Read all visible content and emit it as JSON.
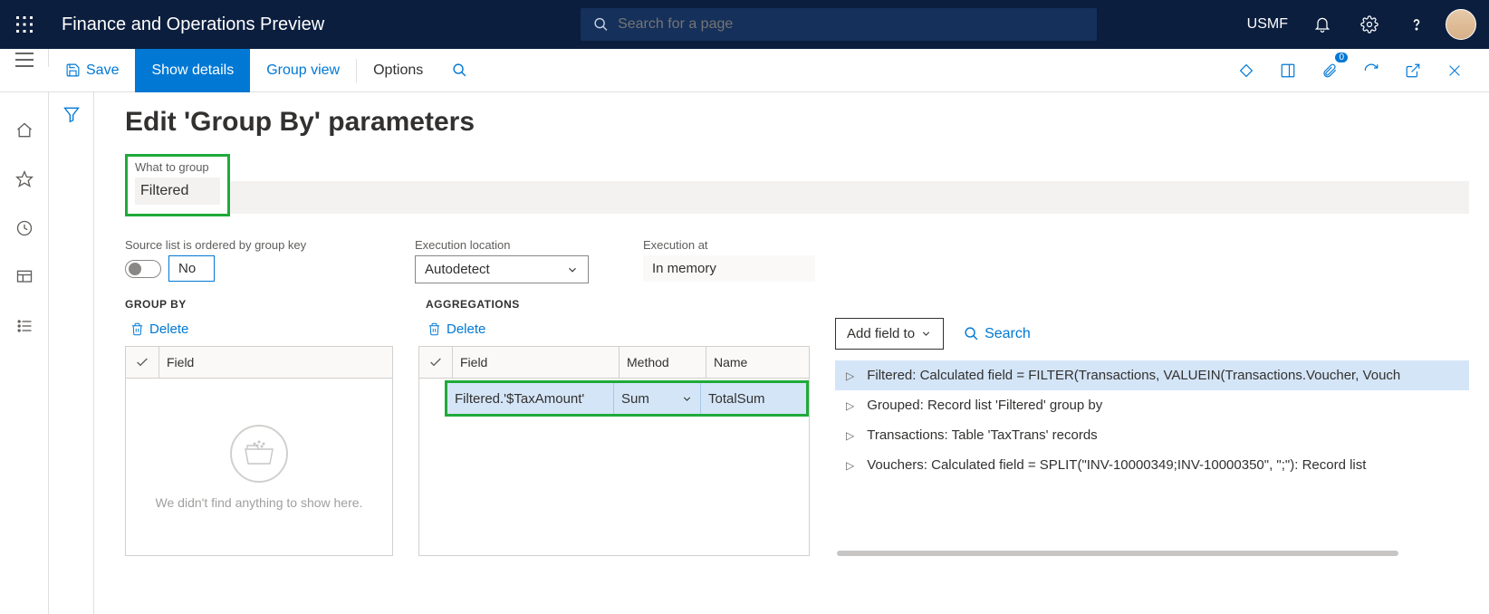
{
  "navbar": {
    "app_title": "Finance and Operations Preview",
    "search_placeholder": "Search for a page",
    "company": "USMF"
  },
  "actionbar": {
    "save": "Save",
    "show_details": "Show details",
    "group_view": "Group view",
    "options": "Options",
    "attachment_count": "0"
  },
  "page": {
    "title": "Edit 'Group By' parameters",
    "what_to_group_label": "What to group",
    "what_to_group_value": "Filtered",
    "ordered_label": "Source list is ordered by group key",
    "ordered_value": "No",
    "exec_loc_label": "Execution location",
    "exec_loc_value": "Autodetect",
    "exec_at_label": "Execution at",
    "exec_at_value": "In memory"
  },
  "groupby": {
    "title": "GROUP BY",
    "delete": "Delete",
    "col_field": "Field",
    "empty_text": "We didn't find anything to show here."
  },
  "aggregations": {
    "title": "AGGREGATIONS",
    "delete": "Delete",
    "col_field": "Field",
    "col_method": "Method",
    "col_name": "Name",
    "rows": [
      {
        "field": "Filtered.'$TaxAmount'",
        "method": "Sum",
        "name": "TotalSum"
      }
    ]
  },
  "tree": {
    "add_field": "Add field to",
    "search": "Search",
    "items": [
      {
        "label": "Filtered: Calculated field = FILTER(Transactions, VALUEIN(Transactions.Voucher, Vouch",
        "selected": true
      },
      {
        "label": "Grouped: Record list 'Filtered' group by",
        "selected": false
      },
      {
        "label": "Transactions: Table 'TaxTrans' records",
        "selected": false
      },
      {
        "label": "Vouchers: Calculated field = SPLIT(\"INV-10000349;INV-10000350\", \";\"): Record list",
        "selected": false
      }
    ]
  }
}
